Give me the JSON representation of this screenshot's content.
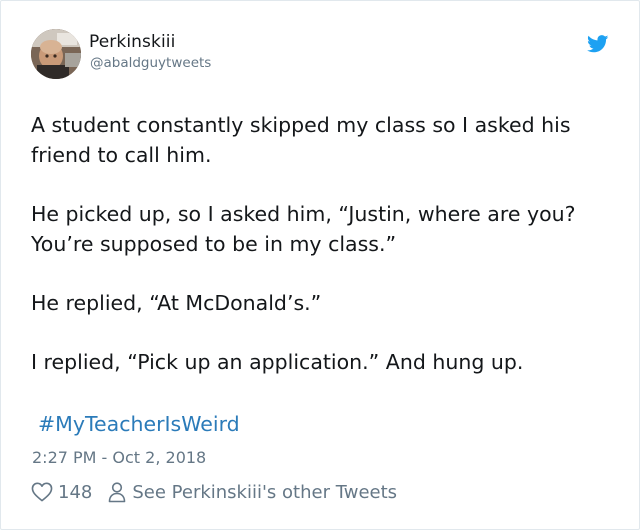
{
  "author": {
    "name": "Perkinskiii",
    "handle": "@abaldguytweets"
  },
  "tweet": {
    "paragraphs": [
      "A student constantly skipped my class so I asked his friend to call him.",
      "He picked up, so I asked him, “Justin, where are you? You’re supposed to be in my class.”",
      "He replied, “At McDonald’s.”",
      "I replied, “Pick up an application.” And hung up."
    ],
    "hashtag": "#MyTeacherIsWeird",
    "timestamp": "2:27 PM - Oct 2, 2018"
  },
  "footer": {
    "like_count": "148",
    "profile_link": "See Perkinskiii's other Tweets"
  },
  "colors": {
    "link": "#2b7bb9",
    "secondary": "#657786",
    "twitter_blue": "#1da1f2"
  },
  "icons": {
    "brand": "twitter-bird-icon",
    "like": "heart-icon",
    "profile": "person-icon"
  }
}
